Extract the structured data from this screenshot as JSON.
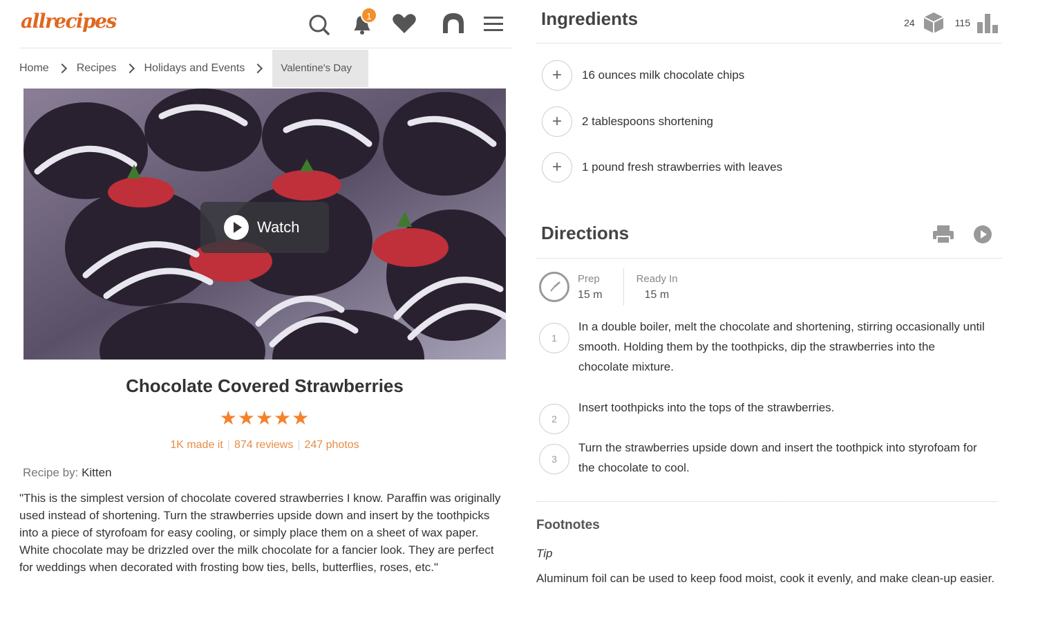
{
  "header": {
    "logo": "allrecipes",
    "notification_count": "1"
  },
  "breadcrumbs": [
    "Home",
    "Recipes",
    "Holidays and Events"
  ],
  "breadcrumb_current": "Valentine's Day",
  "video": {
    "watch_label": "Watch"
  },
  "recipe": {
    "title": "Chocolate Covered Strawberries",
    "rating_stars": 5,
    "made_it": "1K made it",
    "reviews": "874 reviews",
    "photos": "247 photos",
    "byline_label": "Recipe by:",
    "author": "Kitten",
    "description": "\"This is the simplest version of chocolate covered strawberries I know. Paraffin was originally used instead of shortening. Turn the strawberries upside down and insert by the toothpicks into a piece of styrofoam for easy cooling, or simply place them on a sheet of wax paper. White chocolate may be drizzled over the milk chocolate for a fancier look. They are perfect for weddings when decorated with frosting bow ties, bells, butterflies, roses, etc.\""
  },
  "ingredients": {
    "title": "Ingredients",
    "servings": "24",
    "calories": "115",
    "items": [
      "16 ounces milk chocolate chips",
      "2 tablespoons shortening",
      "1 pound fresh strawberries with leaves"
    ]
  },
  "directions": {
    "title": "Directions",
    "prep_label": "Prep",
    "prep_value": "15 m",
    "ready_label": "Ready In",
    "ready_value": "15 m",
    "steps": [
      {
        "num": "1",
        "text": "In a double boiler, melt the chocolate and shortening, stirring occasionally until smooth. Holding them by the toothpicks, dip the strawberries into the chocolate mixture."
      },
      {
        "num": "2",
        "text": "Insert toothpicks into the tops of the strawberries."
      },
      {
        "num": "3",
        "text": "Turn the strawberries upside down and insert the toothpick into styrofoam for the chocolate to cool."
      }
    ]
  },
  "footnotes": {
    "title": "Footnotes",
    "tip_label": "Tip",
    "tip_text": "Aluminum foil can be used to keep food moist, cook it evenly, and make clean-up easier."
  },
  "colors": {
    "brand": "#e0671f",
    "star": "#f4822c",
    "stats": "#e88b45",
    "badge": "#f4902c"
  }
}
